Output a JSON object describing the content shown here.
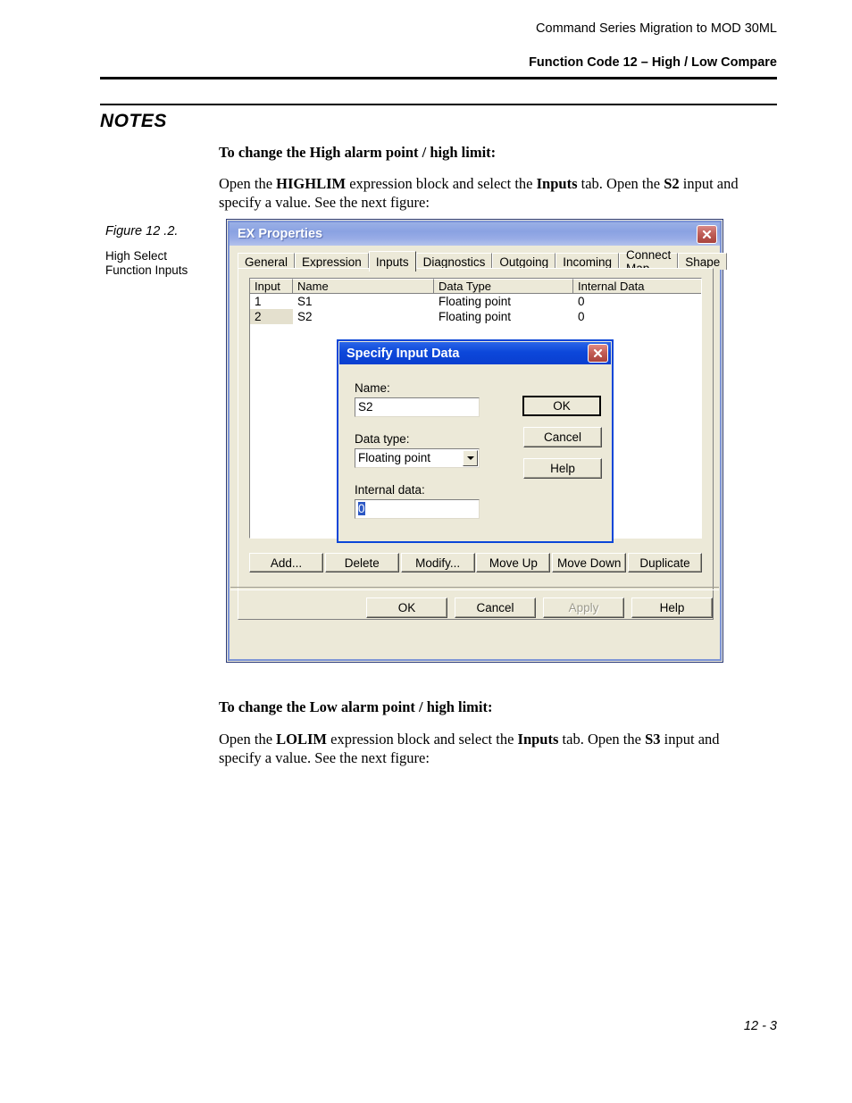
{
  "header": {
    "line1": "Command Series Migration to MOD 30ML",
    "line2": "Function Code 12 – High / Low Compare"
  },
  "notes": {
    "title": "NOTES",
    "section1_heading": "To change the High alarm point / high limit:",
    "section1_text_a": "Open the ",
    "section1_bold_a": "HIGHLIM",
    "section1_text_b": " expression block and select the ",
    "section1_bold_b": "Inputs",
    "section1_text_c": " tab. Open the ",
    "section1_bold_c": "S2",
    "section1_text_d": " input and specify a value. See the next figure:",
    "section2_heading": "To change the Low alarm point / high limit:",
    "section2_text_a": "Open the ",
    "section2_bold_a": "LOLIM",
    "section2_text_b": " expression block and select the ",
    "section2_bold_b": "Inputs",
    "section2_text_c": " tab. Open the ",
    "section2_bold_c": "S3",
    "section2_text_d": " input and specify a value. See the next figure:"
  },
  "figure": {
    "caption": "Figure 12 .2.",
    "subtitle_line1": "High Select",
    "subtitle_line2": "Function Inputs"
  },
  "footer": {
    "page": "12 - 3"
  },
  "dialog": {
    "title": "EX Properties",
    "close_icon": "close-icon",
    "tabs": [
      {
        "label": "General",
        "active": false
      },
      {
        "label": "Expression",
        "active": false
      },
      {
        "label": "Inputs",
        "active": true
      },
      {
        "label": "Diagnostics",
        "active": false
      },
      {
        "label": "Outgoing",
        "active": false
      },
      {
        "label": "Incoming",
        "active": false
      },
      {
        "label": "Connect Map",
        "active": false
      },
      {
        "label": "Shape",
        "active": false
      }
    ],
    "list": {
      "columns": [
        "Input",
        "Name",
        "Data Type",
        "Internal Data"
      ],
      "rows": [
        {
          "input": "1",
          "name": "S1",
          "data_type": "Floating point",
          "internal_data": "0",
          "selected": false
        },
        {
          "input": "2",
          "name": "S2",
          "data_type": "Floating point",
          "internal_data": "0",
          "selected": true
        }
      ]
    },
    "action_buttons": [
      {
        "label": "Add...",
        "enabled": true
      },
      {
        "label": "Delete",
        "enabled": true
      },
      {
        "label": "Modify...",
        "enabled": true
      },
      {
        "label": "Move Up",
        "enabled": true
      },
      {
        "label": "Move Down",
        "enabled": true
      },
      {
        "label": "Duplicate",
        "enabled": true
      }
    ],
    "footer_buttons": [
      {
        "label": "OK",
        "enabled": true
      },
      {
        "label": "Cancel",
        "enabled": true
      },
      {
        "label": "Apply",
        "enabled": false
      },
      {
        "label": "Help",
        "enabled": true
      }
    ]
  },
  "modal": {
    "title": "Specify Input Data",
    "close_icon": "close-icon",
    "name_label": "Name:",
    "name_value": "S2",
    "data_type_label": "Data type:",
    "data_type_value": "Floating point",
    "internal_data_label": "Internal data:",
    "internal_data_value": "0",
    "buttons": [
      {
        "label": "OK",
        "default": true
      },
      {
        "label": "Cancel",
        "default": false
      },
      {
        "label": "Help",
        "default": false
      }
    ]
  },
  "colors": {
    "dialog_face": "#ece9d8",
    "titlebar_blue": "#8aa2e2",
    "modal_titlebar_blue": "#0c47da",
    "close_red": "#c05f59",
    "selection_blue": "#2b57c4"
  }
}
